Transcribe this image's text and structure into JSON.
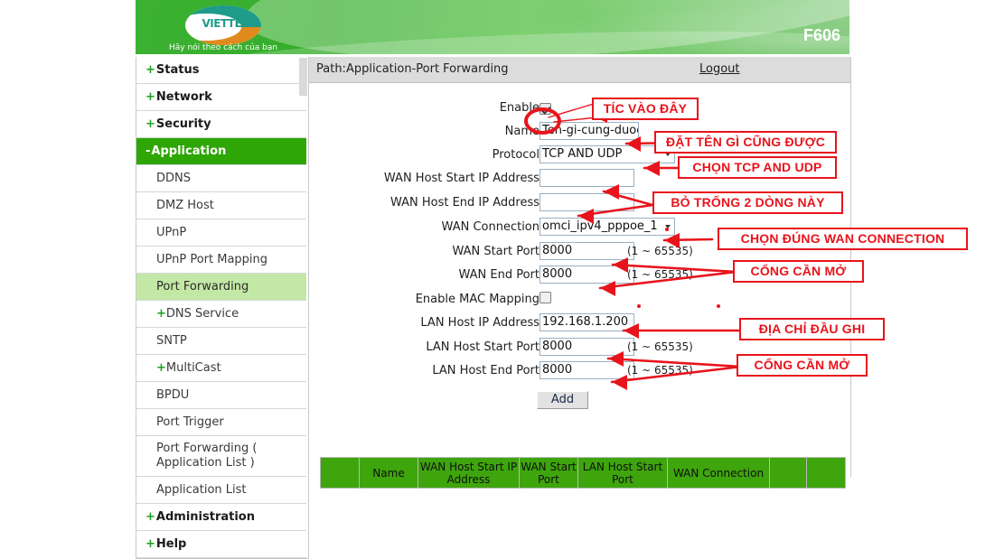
{
  "header": {
    "logo_text": "VIETTEL",
    "slogan": "Hãy nói theo cách của bạn",
    "model": "F606"
  },
  "sidebar": {
    "items": [
      {
        "label": "Status",
        "prefix": "+",
        "type": "top"
      },
      {
        "label": "Network",
        "prefix": "+",
        "type": "top"
      },
      {
        "label": "Security",
        "prefix": "+",
        "type": "top"
      },
      {
        "label": "Application",
        "prefix": "-",
        "type": "active"
      },
      {
        "label": "DDNS",
        "prefix": "",
        "type": "sub"
      },
      {
        "label": "DMZ Host",
        "prefix": "",
        "type": "sub"
      },
      {
        "label": "UPnP",
        "prefix": "",
        "type": "sub"
      },
      {
        "label": "UPnP Port Mapping",
        "prefix": "",
        "type": "sub"
      },
      {
        "label": "Port Forwarding",
        "prefix": "",
        "type": "selected"
      },
      {
        "label": "DNS Service",
        "prefix": "+",
        "type": "sub"
      },
      {
        "label": "SNTP",
        "prefix": "",
        "type": "sub"
      },
      {
        "label": "MultiCast",
        "prefix": "+",
        "type": "sub"
      },
      {
        "label": "BPDU",
        "prefix": "",
        "type": "sub"
      },
      {
        "label": "Port Trigger",
        "prefix": "",
        "type": "sub"
      },
      {
        "label": "Port Forwarding ( Application List )",
        "prefix": "",
        "type": "sub"
      },
      {
        "label": "Application List",
        "prefix": "",
        "type": "sub"
      },
      {
        "label": "Administration",
        "prefix": "+",
        "type": "top"
      },
      {
        "label": "Help",
        "prefix": "+",
        "type": "top"
      }
    ]
  },
  "pathbar": {
    "path": "Path:Application-Port Forwarding",
    "logout": "Logout"
  },
  "form": {
    "enable": {
      "label": "Enable",
      "checked": true
    },
    "name": {
      "label": "Name",
      "value": "Ten-gi-cung-duoc"
    },
    "protocol": {
      "label": "Protocol",
      "value": "TCP AND UDP"
    },
    "wan_host_start_ip": {
      "label": "WAN Host Start IP Address",
      "value": ""
    },
    "wan_host_end_ip": {
      "label": "WAN Host End IP Address",
      "value": ""
    },
    "wan_connection": {
      "label": "WAN Connection",
      "value": "omci_ipv4_pppoe_1"
    },
    "wan_start_port": {
      "label": "WAN Start Port",
      "value": "8000",
      "hint": "(1 ~ 65535)"
    },
    "wan_end_port": {
      "label": "WAN End Port",
      "value": "8000",
      "hint": "(1 ~ 65535)"
    },
    "enable_mac_mapping": {
      "label": "Enable MAC Mapping",
      "checked": false
    },
    "lan_host_ip": {
      "label": "LAN Host IP Address",
      "value": "192.168.1.200"
    },
    "lan_host_start_port": {
      "label": "LAN Host Start Port",
      "value": "8000",
      "hint": "(1 ~ 65535)"
    },
    "lan_host_end_port": {
      "label": "LAN Host End Port",
      "value": "8000",
      "hint": "(1 ~ 65535)"
    },
    "add_button": "Add"
  },
  "table": {
    "headers": [
      "",
      "Name",
      "WAN Host Start IP Address",
      "WAN Start Port",
      "LAN Host Start Port",
      "WAN Connection",
      "",
      ""
    ]
  },
  "annotations": [
    {
      "id": "a1",
      "text": "TÍC VÀO ĐÂY"
    },
    {
      "id": "a2",
      "text": "ĐẶT TÊN GÌ CŨNG ĐƯỢC"
    },
    {
      "id": "a3",
      "text": "CHỌN TCP AND UDP"
    },
    {
      "id": "a4",
      "text": "BỎ TRỐNG 2 DÒNG NÀY"
    },
    {
      "id": "a5",
      "text": "CHỌN ĐÚNG WAN CONNECTION"
    },
    {
      "id": "a6",
      "text": "CỔNG CẦN MỞ"
    },
    {
      "id": "a7",
      "text": "ĐỊA CHỈ ĐẦU GHI"
    },
    {
      "id": "a8",
      "text": "CỔNG CẦN MỞ"
    }
  ],
  "colors": {
    "brand_green": "#2fab27",
    "active_green": "#2ea605",
    "selected_green": "#c3e8a5",
    "annotation_red": "#e8141c",
    "table_header_green": "#3ea50c"
  }
}
